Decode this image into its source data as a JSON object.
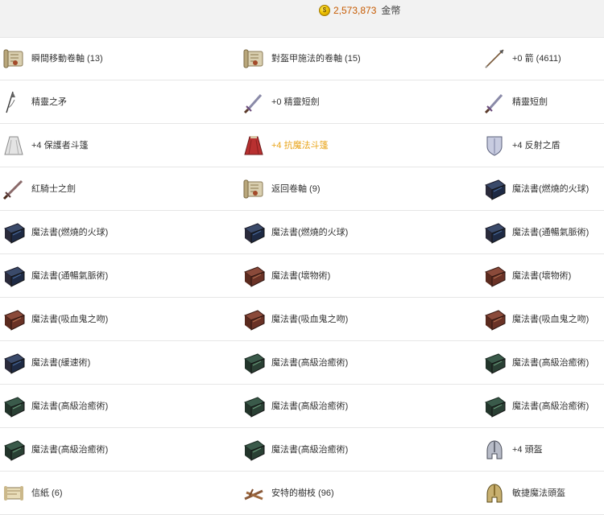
{
  "header": {
    "gold_amount": "2,573,873",
    "gold_unit": "金幣",
    "gold_icon": "gold-coin-icon"
  },
  "colors": {
    "gold_amount_text": "#c65a00",
    "highlight_text": "#e8a317",
    "divider": "#e6e6e6"
  },
  "items": [
    [
      {
        "label": "瞬間移動卷軸 (13)",
        "icon": "scroll"
      },
      {
        "label": "對盔甲施法的卷軸 (15)",
        "icon": "scroll"
      },
      {
        "label": "+0 箭 (4611)",
        "icon": "arrow"
      }
    ],
    [
      {
        "label": "精靈之矛",
        "icon": "spear"
      },
      {
        "label": "+0 精靈短劍",
        "icon": "dagger"
      },
      {
        "label": "精靈短劍",
        "icon": "dagger"
      }
    ],
    [
      {
        "label": "+4 保護者斗篷",
        "icon": "cloak-white"
      },
      {
        "label": "+4 抗魔法斗篷",
        "icon": "cloak-red",
        "highlight": true
      },
      {
        "label": "+4 反射之盾",
        "icon": "shield"
      }
    ],
    [
      {
        "label": "紅騎士之劍",
        "icon": "sword"
      },
      {
        "label": "返回卷軸 (9)",
        "icon": "scroll"
      },
      {
        "label": "魔法書(燃燒的火球)",
        "icon": "book-dark"
      }
    ],
    [
      {
        "label": "魔法書(燃燒的火球)",
        "icon": "book-dark"
      },
      {
        "label": "魔法書(燃燒的火球)",
        "icon": "book-dark"
      },
      {
        "label": "魔法書(通暢氣脈術)",
        "icon": "book-dark"
      }
    ],
    [
      {
        "label": "魔法書(通暢氣脈術)",
        "icon": "book-dark"
      },
      {
        "label": "魔法書(壞物術)",
        "icon": "book-brown"
      },
      {
        "label": "魔法書(壞物術)",
        "icon": "book-brown"
      }
    ],
    [
      {
        "label": "魔法書(吸血鬼之吻)",
        "icon": "book-brown"
      },
      {
        "label": "魔法書(吸血鬼之吻)",
        "icon": "book-brown"
      },
      {
        "label": "魔法書(吸血鬼之吻)",
        "icon": "book-brown"
      }
    ],
    [
      {
        "label": "魔法書(緩速術)",
        "icon": "book-dark"
      },
      {
        "label": "魔法書(高級治癒術)",
        "icon": "book-green"
      },
      {
        "label": "魔法書(高級治癒術)",
        "icon": "book-green"
      }
    ],
    [
      {
        "label": "魔法書(高級治癒術)",
        "icon": "book-green"
      },
      {
        "label": "魔法書(高級治癒術)",
        "icon": "book-green"
      },
      {
        "label": "魔法書(高級治癒術)",
        "icon": "book-green"
      }
    ],
    [
      {
        "label": "魔法書(高級治癒術)",
        "icon": "book-green"
      },
      {
        "label": "魔法書(高級治癒術)",
        "icon": "book-green"
      },
      {
        "label": "+4 頭盔",
        "icon": "helmet"
      }
    ],
    [
      {
        "label": "信紙 (6)",
        "icon": "letter"
      },
      {
        "label": "安特的樹枝 (96)",
        "icon": "branch"
      },
      {
        "label": "敏捷魔法頭盔",
        "icon": "helmet-gold"
      }
    ]
  ]
}
